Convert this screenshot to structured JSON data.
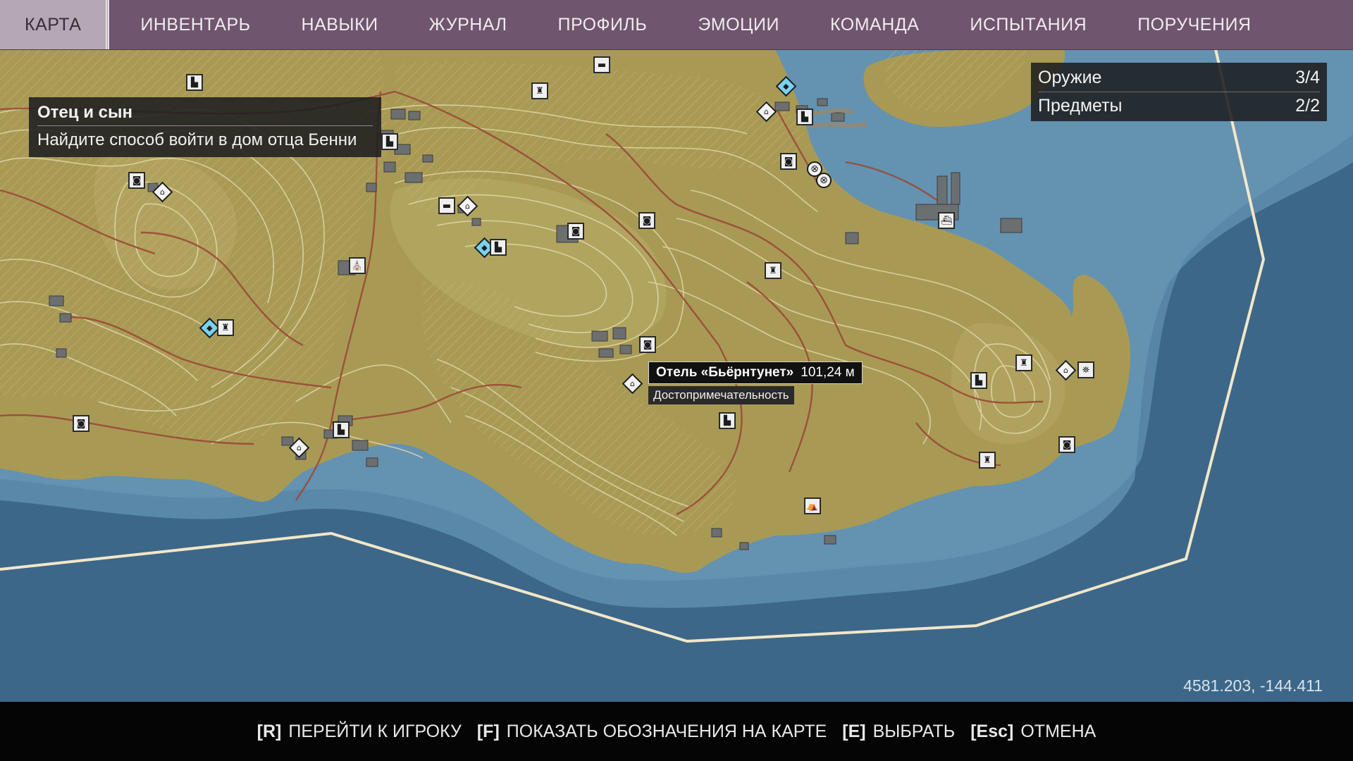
{
  "tabs": [
    {
      "label": "КАРТА",
      "active": true
    },
    {
      "label": "ИНВЕНТАРЬ"
    },
    {
      "label": "НАВЫКИ"
    },
    {
      "label": "ЖУРНАЛ"
    },
    {
      "label": "ПРОФИЛЬ"
    },
    {
      "label": "ЭМОЦИИ"
    },
    {
      "label": "КОМАНДА"
    },
    {
      "label": "ИСПЫТАНИЯ"
    },
    {
      "label": "ПОРУЧЕНИЯ"
    }
  ],
  "objective": {
    "title": "Отец и сын",
    "description": "Найдите способ войти в дом отца Бенни"
  },
  "collectibles": [
    {
      "label": "Оружие",
      "count": "3/4"
    },
    {
      "label": "Предметы",
      "count": "2/2"
    }
  ],
  "tooltip": {
    "name": "Отель «Бьёрнтунет»",
    "distance": "101,24 м",
    "category": "Достопримечательность"
  },
  "cursor_coordinates": "4581.203, -144.411",
  "hints": [
    {
      "key": "[R]",
      "label": "ПЕРЕЙТИ К ИГРОКУ"
    },
    {
      "key": "[F]",
      "label": "ПОКАЗАТЬ ОБОЗНАЧЕНИЯ НА КАРТЕ"
    },
    {
      "key": "[E]",
      "label": "ВЫБРАТЬ"
    },
    {
      "key": "[Esc]",
      "label": "ОТМЕНА"
    }
  ],
  "colors": {
    "menu_bar": "#6f556d",
    "active_tab": "#b5a7b3",
    "deep_water": "#3d6789",
    "shallow_water": "#5a88a9",
    "land": "#a89a55",
    "roads": "#9b4a36",
    "boundary": "#f1e7c8"
  }
}
